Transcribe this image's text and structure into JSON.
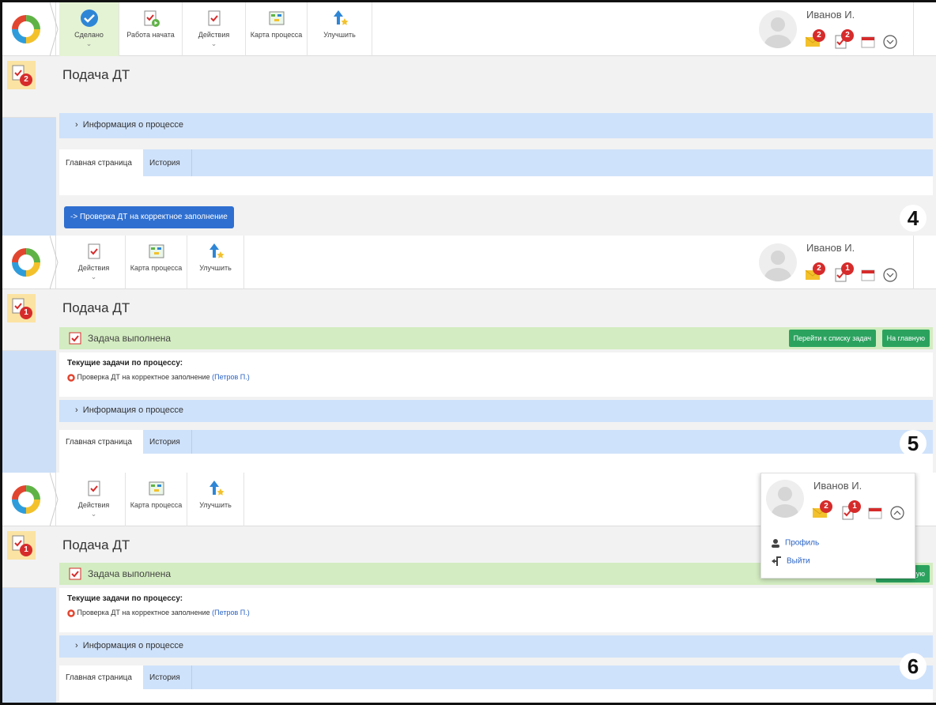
{
  "user": {
    "name": "Иванов И."
  },
  "panels": [
    {
      "step": "4",
      "toolbar": [
        {
          "label": "Сделано",
          "icon": "check-circle-icon",
          "active": true,
          "dropdown": true
        },
        {
          "label": "Работа начата",
          "icon": "task-start-icon",
          "active": false,
          "dropdown": false
        },
        {
          "label": "Действия",
          "icon": "task-check-icon",
          "active": false,
          "dropdown": true
        },
        {
          "label": "Карта процесса",
          "icon": "process-map-icon",
          "active": false,
          "dropdown": false
        },
        {
          "label": "Улучшить",
          "icon": "improve-icon",
          "active": false,
          "dropdown": false
        }
      ],
      "badges": {
        "messages": "2",
        "tasks": "2",
        "rail": "2"
      },
      "title": "Подача ДТ",
      "info_label": "Информация о процессе",
      "tabs": [
        "Главная страница",
        "История"
      ],
      "action_button": "-> Проверка ДТ на корректное заполнение"
    },
    {
      "step": "5",
      "toolbar": [
        {
          "label": "Действия",
          "icon": "task-check-icon",
          "dropdown": true
        },
        {
          "label": "Карта процесса",
          "icon": "process-map-icon",
          "dropdown": false
        },
        {
          "label": "Улучшить",
          "icon": "improve-icon",
          "dropdown": false
        }
      ],
      "badges": {
        "messages": "2",
        "tasks": "1",
        "rail": "1"
      },
      "title": "Подача ДТ",
      "done_label": "Задача выполнена",
      "goto_tasks_button": "Перейти к списку задач",
      "home_button": "На главную",
      "current_tasks_heading": "Текущие задачи по процессу:",
      "current_task": "Проверка ДТ на корректное заполнение",
      "current_task_assignee": "(Петров П.)",
      "info_label": "Информация о процессе",
      "tabs": [
        "Главная страница",
        "История"
      ]
    },
    {
      "step": "6",
      "toolbar": [
        {
          "label": "Действия",
          "icon": "task-check-icon",
          "dropdown": true
        },
        {
          "label": "Карта процесса",
          "icon": "process-map-icon",
          "dropdown": false
        },
        {
          "label": "Улучшить",
          "icon": "improve-icon",
          "dropdown": false
        }
      ],
      "badges": {
        "messages": "2",
        "tasks": "1",
        "rail": "1"
      },
      "title": "Подача ДТ",
      "done_label": "Задача выполнена",
      "home_button_partial": "ную",
      "current_tasks_heading": "Текущие задачи по процессу:",
      "current_task": "Проверка ДТ на корректное заполнение",
      "current_task_assignee": "(Петров П.)",
      "info_label": "Информация о процессе",
      "tabs": [
        "Главная страница",
        "История"
      ],
      "user_menu": [
        "Профиль",
        "Выйти"
      ]
    }
  ],
  "colors": {
    "accent_blue": "#2f6fd0",
    "info_bar": "#cfe2fb",
    "done_bar": "#d3ecc1",
    "green_button": "#2ba35f",
    "badge_red": "#d62b2b"
  }
}
